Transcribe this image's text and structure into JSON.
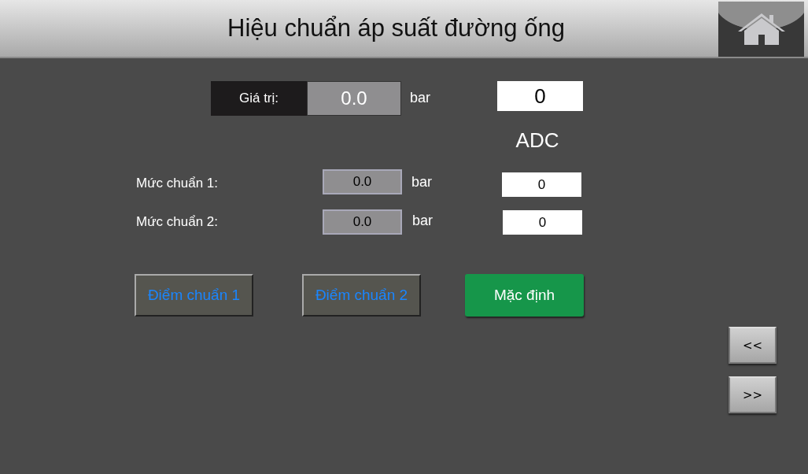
{
  "title": "Hiệu chuẩn áp suất đường ống",
  "reading": {
    "label": "Giá trị:",
    "value": "0.0",
    "unit": "bar",
    "adc": "0"
  },
  "adc_label": "ADC",
  "levels": [
    {
      "label": "Mức chuẩn 1:",
      "value": "0.0",
      "unit": "bar",
      "adc": "0"
    },
    {
      "label": "Mức chuẩn 2:",
      "value": "0.0",
      "unit": "bar",
      "adc": "0"
    }
  ],
  "buttons": [
    {
      "label": "Điểm chuẩn 1",
      "kind": "point"
    },
    {
      "label": "Điểm chuẩn 2",
      "kind": "point"
    },
    {
      "label": "Mặc định",
      "kind": "default"
    }
  ],
  "nav": [
    {
      "label": "<<"
    },
    {
      "label": ">>"
    }
  ]
}
